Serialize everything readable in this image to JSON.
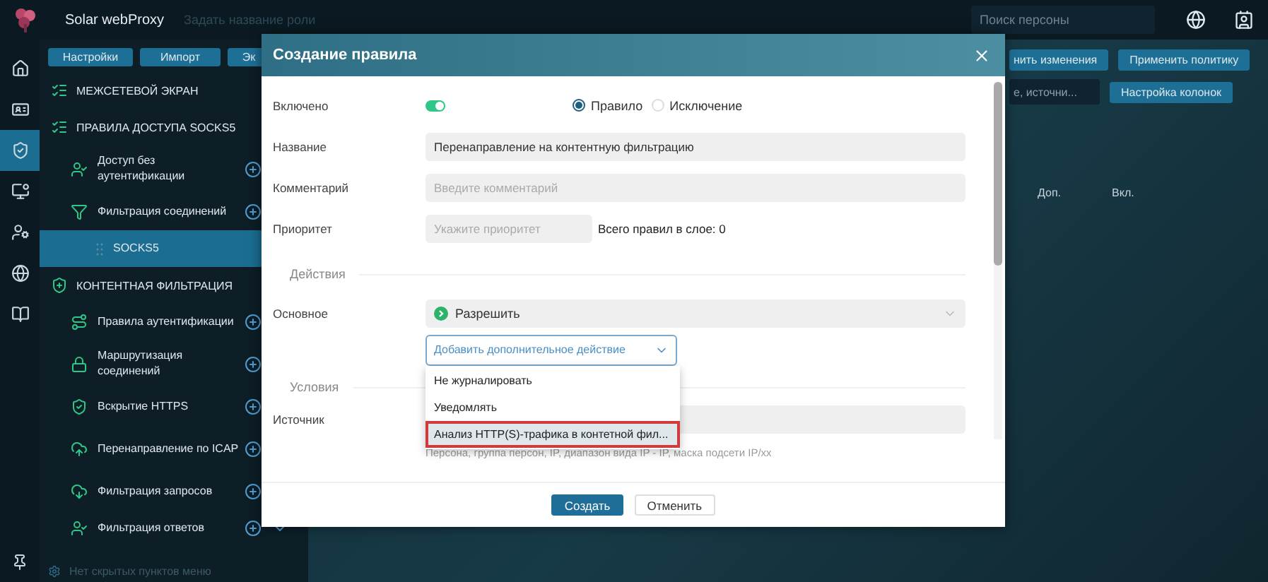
{
  "header": {
    "app_title": "Solar webProxy",
    "role_placeholder": "Задать название роли",
    "search_placeholder": "Поиск персоны"
  },
  "rail": [
    {
      "kind": "home",
      "selected": false
    },
    {
      "kind": "card",
      "selected": false
    },
    {
      "kind": "shield",
      "selected": true
    },
    {
      "kind": "monitor",
      "selected": false
    },
    {
      "kind": "user",
      "selected": false
    },
    {
      "kind": "globe",
      "selected": false
    },
    {
      "kind": "book",
      "selected": false
    }
  ],
  "toolbar": [
    "Настройки",
    "Импорт",
    "Эк"
  ],
  "nav": [
    {
      "label": "МЕЖСЕТЕВОЙ ЭКРАН"
    },
    {
      "label": "ПРАВИЛА ДОСТУПА SOCKS5",
      "children": [
        {
          "label": "Доступ без аутентификации",
          "selected": false
        },
        {
          "label": "Фильтрация соединений",
          "selected": false,
          "children": [
            {
              "label": "SOCKS5",
              "selected": true
            }
          ]
        }
      ]
    },
    {
      "label": "КОНТЕНТНАЯ ФИЛЬТРАЦИЯ",
      "children": [
        {
          "label": "Правила аутентификации",
          "selected": false
        },
        {
          "label": "Маршрутизация соединений",
          "selected": false
        },
        {
          "label": "Вскрытие HTTPS",
          "selected": false
        },
        {
          "label": "Перенаправление по ICAP",
          "selected": false
        },
        {
          "label": "Фильтрация запросов",
          "selected": false
        },
        {
          "label": "Фильтрация ответов",
          "selected": false,
          "expanded": false
        }
      ]
    }
  ],
  "nav_hint": "Нет скрытых пунктов меню",
  "content": {
    "buttons": [
      "нить изменения",
      "Применить политику"
    ],
    "search_value": "е, источни...",
    "columns_button": "Настройка колонок",
    "columns": [
      "Доп.",
      "Вкл."
    ]
  },
  "modal": {
    "title": "Создание правила",
    "enabled": {
      "label": "Включено",
      "on": true
    },
    "type_options": [
      {
        "label": "Правило",
        "selected": true
      },
      {
        "label": "Исключение",
        "selected": false
      }
    ],
    "name": {
      "label": "Название",
      "value": "Перенаправление на контентную фильтрацию"
    },
    "comment": {
      "label": "Комментарий",
      "placeholder": "Введите комментарий"
    },
    "priority": {
      "label": "Приоритет",
      "placeholder": "Укажите приоритет",
      "total": "Всего правил в слое: 0"
    },
    "actions_section": "Действия",
    "main_action": {
      "label": "Основное",
      "value": "Разрешить"
    },
    "extra_action": {
      "placeholder": "Добавить дополнительное действие",
      "expanded": true,
      "options": [
        {
          "label": "Не журналировать",
          "highlighted": false
        },
        {
          "label": "Уведомлять",
          "highlighted": false
        },
        {
          "label": "Анализ HTTP(S)-трафика в контетной фил...",
          "highlighted": true
        }
      ]
    },
    "conditions_section": "Условия",
    "source": {
      "label": "Источник",
      "hint": "Персона, группа персон, IP, диапазон вида IP - IP, маска подсети IP/xx"
    },
    "buttons": [
      {
        "label": "Создать",
        "kind": "primary"
      },
      {
        "label": "Отменить",
        "kind": "secondary"
      }
    ]
  }
}
